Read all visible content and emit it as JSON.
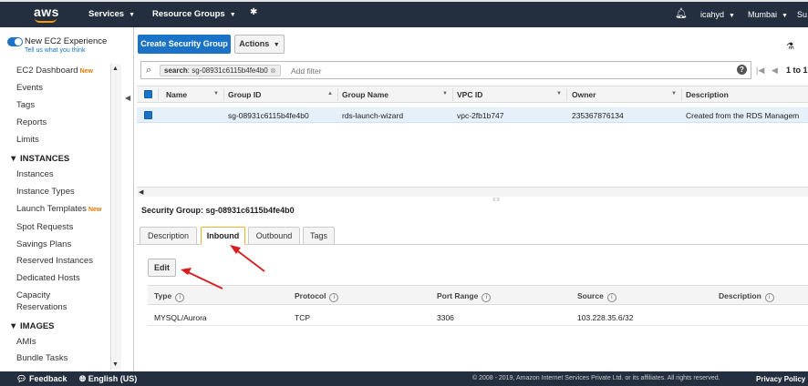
{
  "topbar": {
    "logo": "aws",
    "services": "Services",
    "resource_groups": "Resource Groups",
    "user": "icahyd",
    "region": "Mumbai",
    "support": "Su"
  },
  "sidebar": {
    "new_experience_label": "New EC2 Experience",
    "new_experience_link": "Tell us what you think",
    "items": [
      {
        "label": "EC2 Dashboard",
        "badge": "New"
      },
      {
        "label": "Events"
      },
      {
        "label": "Tags"
      },
      {
        "label": "Reports"
      },
      {
        "label": "Limits"
      }
    ],
    "instances_header": "INSTANCES",
    "instances_items": [
      {
        "label": "Instances"
      },
      {
        "label": "Instance Types"
      },
      {
        "label": "Launch Templates",
        "badge": "New"
      },
      {
        "label": "Spot Requests"
      },
      {
        "label": "Savings Plans"
      },
      {
        "label": "Reserved Instances"
      },
      {
        "label": "Dedicated Hosts"
      },
      {
        "label": "Capacity"
      },
      {
        "label": "Reservations"
      }
    ],
    "images_header": "IMAGES",
    "images_items": [
      {
        "label": "AMIs"
      },
      {
        "label": "Bundle Tasks"
      }
    ]
  },
  "toolbar": {
    "create_label": "Create Security Group",
    "actions_label": "Actions"
  },
  "search": {
    "chip_key": "search",
    "chip_value": ": sg-08931c6115b4fe4b0",
    "placeholder": "Add filter",
    "pager_text": "1 to 1"
  },
  "grid": {
    "columns": [
      "Name",
      "Group ID",
      "Group Name",
      "VPC ID",
      "Owner",
      "Description"
    ],
    "rows": [
      {
        "name": "",
        "group_id": "sg-08931c6115b4fe4b0",
        "group_name": "rds-launch-wizard",
        "vpc_id": "vpc-2fb1b747",
        "owner": "235367876134",
        "description": "Created from the RDS Managem"
      }
    ]
  },
  "detail": {
    "title": "Security Group: sg-08931c6115b4fe4b0",
    "tabs": [
      "Description",
      "Inbound",
      "Outbound",
      "Tags"
    ],
    "active_tab": "Inbound",
    "edit_label": "Edit",
    "rules_columns": [
      "Type",
      "Protocol",
      "Port Range",
      "Source",
      "Description"
    ],
    "rules_rows": [
      {
        "type": "MYSQL/Aurora",
        "protocol": "TCP",
        "port_range": "3306",
        "source": "103.228.35.6/32",
        "description": ""
      }
    ]
  },
  "footer": {
    "feedback": "Feedback",
    "language": "English (US)",
    "copyright": "© 2008 - 2019, Amazon Internet Services Private Ltd. or its affiliates. All rights reserved.",
    "privacy": "Privacy Policy"
  },
  "colors": {
    "topbar": "#232f3e",
    "primary": "#1a73c7",
    "accent": "#f90",
    "annotation_arrow": "#d81e1e"
  }
}
